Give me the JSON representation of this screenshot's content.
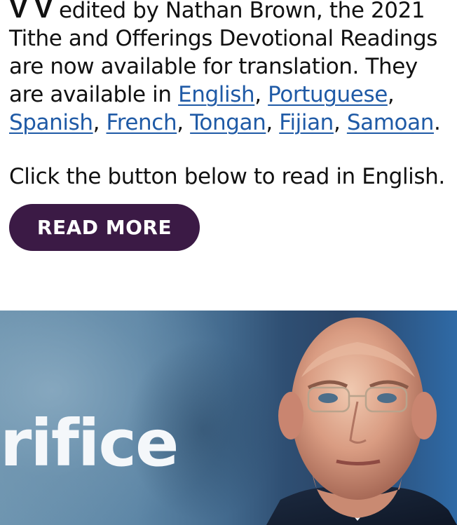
{
  "article": {
    "dropcap_tail": "V V",
    "intro_text": " edited by Nathan Brown, the 2021 Tithe and Offerings Devotional Readings are now available for translation. They are available in ",
    "languages": [
      {
        "label": "English",
        "sep": ", "
      },
      {
        "label": "Portuguese",
        "sep": ", "
      },
      {
        "label": "Spanish",
        "sep": ", "
      },
      {
        "label": "French",
        "sep": ", "
      },
      {
        "label": "Tongan",
        "sep": ", "
      },
      {
        "label": "Fijian",
        "sep": ", "
      },
      {
        "label": "Samoan",
        "sep": "."
      }
    ],
    "cta_text": "Click the button below to read in English.",
    "button_label": "READ MORE"
  },
  "banner": {
    "text": "rifice"
  },
  "colors": {
    "link": "#1f5aa6",
    "button_bg": "#3b1a45",
    "button_text": "#ffffff",
    "banner_blue": "#42698d"
  }
}
